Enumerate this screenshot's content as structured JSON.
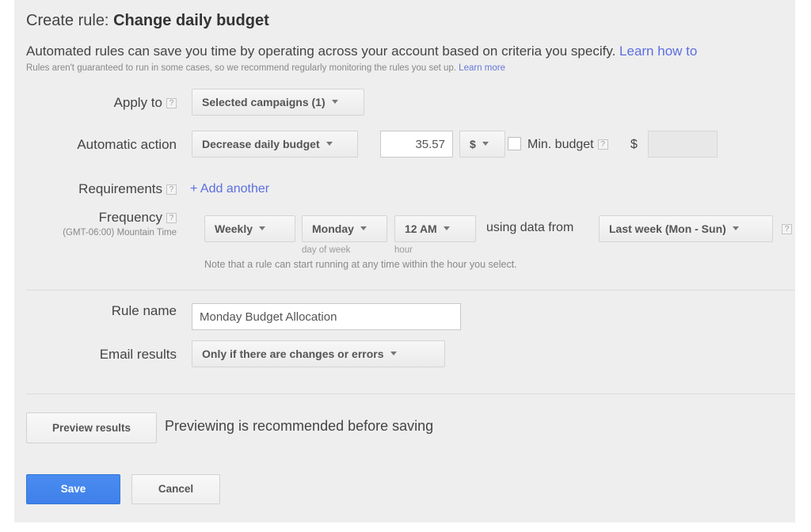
{
  "header": {
    "title_prefix": "Create rule: ",
    "title_rule": "Change daily budget",
    "description": "Automated rules can save you time by operating across your account based on criteria you specify. ",
    "description_link": "Learn how to",
    "subdescription": "Rules aren't guaranteed to run in some cases, so we recommend regularly monitoring the rules you set up. ",
    "subdescription_link": "Learn more"
  },
  "apply_to": {
    "label": "Apply to",
    "help": "?",
    "value": "Selected campaigns (1)"
  },
  "automatic_action": {
    "label": "Automatic action",
    "action_value": "Decrease daily budget",
    "amount_value": "35.57",
    "currency_value": "$",
    "min_budget_label": "Min. budget",
    "min_budget_help": "?",
    "min_budget_checked": false,
    "min_budget_currency": "$",
    "min_budget_value": ""
  },
  "requirements": {
    "label": "Requirements",
    "help": "?",
    "add_another": "+ Add another"
  },
  "frequency": {
    "label": "Frequency",
    "help": "?",
    "timezone": "(GMT-06:00) Mountain Time",
    "interval_value": "Weekly",
    "day_value": "Monday",
    "day_caption": "day of week",
    "hour_value": "12 AM",
    "hour_caption": "hour",
    "using_data_from": "using data from",
    "data_range_value": "Last week (Mon - Sun)",
    "data_range_help": "?",
    "note": "Note that a rule can start running at any time within the hour you select."
  },
  "rule_name": {
    "label": "Rule name",
    "value": "Monday Budget Allocation",
    "placeholder": ""
  },
  "email_results": {
    "label": "Email results",
    "value": "Only if there are changes or errors"
  },
  "preview": {
    "button_label": "Preview results",
    "hint": "Previewing is recommended before saving"
  },
  "actions": {
    "save_label": "Save",
    "cancel_label": "Cancel"
  },
  "colors": {
    "panel_bg": "#eeeeee",
    "primary_blue": "#4285f4",
    "link_blue": "#5b6ee1",
    "text": "#444444"
  }
}
